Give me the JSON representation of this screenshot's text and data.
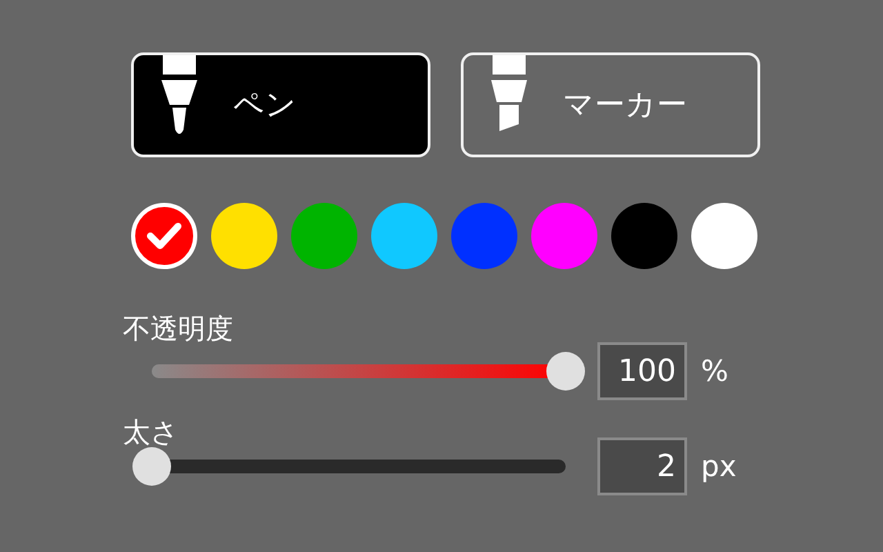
{
  "tools": [
    {
      "kind": "pen",
      "label": "ペン",
      "selected": true
    },
    {
      "kind": "marker",
      "label": "マーカー",
      "selected": false
    }
  ],
  "colors": [
    {
      "color": "#ff0000",
      "selected": true
    },
    {
      "color": "#ffe000",
      "selected": false
    },
    {
      "color": "#00b400",
      "selected": false
    },
    {
      "color": "#10c8ff",
      "selected": false
    },
    {
      "color": "#0030ff",
      "selected": false
    },
    {
      "color": "#ff00ff",
      "selected": false
    },
    {
      "color": "#000000",
      "selected": false
    },
    {
      "color": "#ffffff",
      "selected": false
    }
  ],
  "sliders": [
    {
      "kind": "gradient",
      "label": "不透明度",
      "level": 1,
      "value": "100",
      "unit": "%"
    },
    {
      "kind": "plain",
      "label": "太さ",
      "level": 0,
      "value": "2",
      "unit": "px"
    }
  ]
}
